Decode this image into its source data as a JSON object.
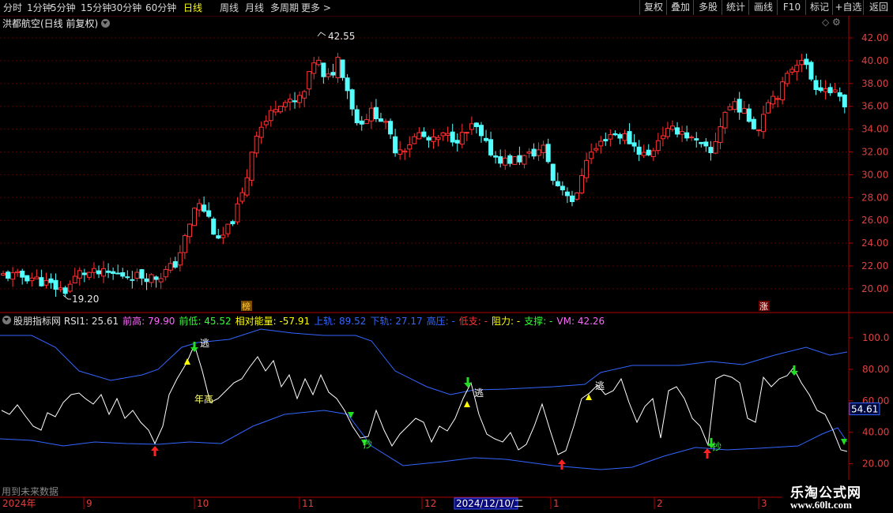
{
  "toolbar": {
    "periods": [
      "分时",
      "1分钟",
      "5分钟",
      "15分钟",
      "30分钟",
      "60分钟",
      "日线",
      "周线",
      "月线",
      "多周期",
      "更多 >"
    ],
    "active_period": "日线",
    "right_buttons": [
      "复权",
      "叠加",
      "多股",
      "统计",
      "画线",
      "F10",
      "标记",
      "+自选",
      "返回"
    ]
  },
  "main_chart": {
    "title": "洪都航空(日线 前复权)",
    "high_label": "42.55",
    "low_label": "19.20",
    "y_ticks": [
      "42.00",
      "40.00",
      "38.00",
      "36.00",
      "34.00",
      "32.00",
      "30.00",
      "28.00",
      "26.00",
      "24.00",
      "22.00",
      "20.00"
    ],
    "marker_left": "榜",
    "marker_right": "涨",
    "colors": {
      "up": "#ff3232",
      "down": "#54ffff",
      "grid": "#5a0000",
      "border": "#b00000"
    }
  },
  "indicator": {
    "name": "股朋指标网",
    "fields": [
      {
        "label": "RSI1:",
        "value": "25.61",
        "color": "#e0e0e0"
      },
      {
        "label": "前高:",
        "value": "79.90",
        "color": "#ff66ff"
      },
      {
        "label": "前低:",
        "value": "45.52",
        "color": "#33ff33"
      },
      {
        "label": "相对能量:",
        "value": "-57.91",
        "color": "#ffff00"
      },
      {
        "label": "上轨:",
        "value": "89.52",
        "color": "#3366ff"
      },
      {
        "label": "下轨:",
        "value": "27.17",
        "color": "#3366ff"
      },
      {
        "label": "高压:",
        "value": "-",
        "color": "#3366ff"
      },
      {
        "label": "低支:",
        "value": "-",
        "color": "#ff3333"
      },
      {
        "label": "阻力:",
        "value": "-",
        "color": "#ffff00"
      },
      {
        "label": "支撑:",
        "value": "-",
        "color": "#33ff33"
      },
      {
        "label": "VM:",
        "value": "42.26",
        "color": "#ff66ff"
      }
    ],
    "y_ticks": [
      "100.0",
      "80.00",
      "60.00",
      "40.00",
      "20.00"
    ],
    "current_value": "54.61",
    "labels": {
      "escape": "逃",
      "buy": "抄",
      "year_high": "年高"
    },
    "future_data_note": "用到未来数据"
  },
  "timeline": {
    "year_label": "2024年",
    "months": [
      "9",
      "10",
      "11",
      "12",
      "1",
      "2",
      "3"
    ],
    "cursor_date": "2024/12/10/二"
  },
  "watermark": {
    "line1": "乐淘公式网",
    "line2": "www.60lt.com"
  }
}
